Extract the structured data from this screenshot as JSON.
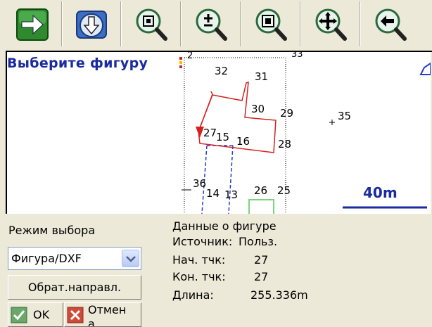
{
  "toolbar": {
    "buttons": [
      {
        "name": "forward-arrow"
      },
      {
        "name": "download-compass"
      },
      {
        "name": "zoom-extents"
      },
      {
        "name": "zoom-in-out"
      },
      {
        "name": "zoom-window"
      },
      {
        "name": "pan"
      },
      {
        "name": "zoom-previous"
      }
    ]
  },
  "map": {
    "prompt": "Выберите фигуру",
    "scale_label": "40m",
    "point_labels": [
      "2",
      "33",
      "32",
      "31",
      "30",
      "29",
      "35",
      "27",
      "15",
      "16",
      "28",
      "36",
      "14",
      "13",
      "26",
      "25"
    ]
  },
  "panel": {
    "mode_label": "Режим выбора",
    "mode_value": "Фигура/DXF",
    "reverse_button": "Обрат.направл.",
    "ok_button": "OK",
    "cancel_button": "Отмен",
    "cancel_button_cut": "а"
  },
  "figure": {
    "title": "Данные о фигуре",
    "source_label": "Источник:",
    "source_value": "Польз.",
    "start_label": "Нач. тчк:",
    "start_value": "27",
    "end_label": "Кон. тчк:",
    "end_value": "27",
    "length_label": "Длина:",
    "length_value": "255.336m"
  }
}
